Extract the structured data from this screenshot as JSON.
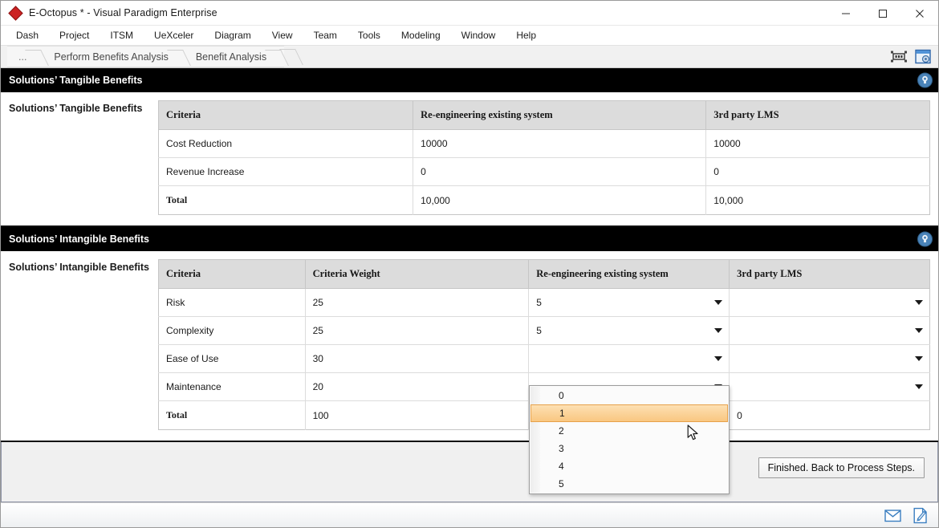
{
  "window": {
    "title": "E-Octopus * - Visual Paradigm Enterprise",
    "logo_icon": "vp-diamond-logo-icon",
    "minimize_label": "—",
    "maximize_label": "☐",
    "close_label": "✕"
  },
  "menubar": {
    "items": [
      {
        "label": "Dash"
      },
      {
        "label": "Project"
      },
      {
        "label": "ITSM"
      },
      {
        "label": "UeXceler"
      },
      {
        "label": "Diagram"
      },
      {
        "label": "View"
      },
      {
        "label": "Team"
      },
      {
        "label": "Tools"
      },
      {
        "label": "Modeling"
      },
      {
        "label": "Window"
      },
      {
        "label": "Help"
      }
    ]
  },
  "breadcrumb": {
    "items": [
      {
        "label": "..."
      },
      {
        "label": "Perform Benefits Analysis"
      },
      {
        "label": "Benefit Analysis"
      }
    ],
    "tools": [
      {
        "icon": "fit-diagram-icon"
      },
      {
        "icon": "open-spec-window-icon"
      }
    ]
  },
  "sections": [
    {
      "bar_title": "Solutions’ Tangible Benefits",
      "badge_icon": "info-bulb-badge-icon",
      "left_label": "Solutions’ Tangible Benefits",
      "table": {
        "columns": [
          "Criteria",
          "Re-engineering existing system",
          "3rd party LMS"
        ],
        "rows": [
          {
            "cells": [
              "Cost Reduction",
              "10000",
              "10000"
            ],
            "total": false
          },
          {
            "cells": [
              "Revenue Increase",
              "0",
              "0"
            ],
            "total": false
          },
          {
            "cells": [
              "Total",
              "10,000",
              "10,000"
            ],
            "total": true
          }
        ]
      }
    },
    {
      "bar_title": "Solutions’ Intangible Benefits",
      "badge_icon": "info-bulb-badge-icon",
      "left_label": "Solutions’ Intangible Benefits",
      "table": {
        "columns": [
          "Criteria",
          "Criteria Weight",
          "Re-engineering existing system",
          "3rd party LMS"
        ],
        "rows": [
          {
            "cells": [
              "Risk",
              "25",
              "5",
              ""
            ],
            "total": false,
            "select_cols": [
              2,
              3
            ]
          },
          {
            "cells": [
              "Complexity",
              "25",
              "5",
              ""
            ],
            "total": false,
            "select_cols": [
              2,
              3
            ]
          },
          {
            "cells": [
              "Ease of Use",
              "30",
              "",
              ""
            ],
            "total": false,
            "select_cols": [
              2,
              3
            ]
          },
          {
            "cells": [
              "Maintenance",
              "20",
              "",
              ""
            ],
            "total": false,
            "select_cols": [
              2,
              3
            ]
          },
          {
            "cells": [
              "Total",
              "100",
              "",
              "0"
            ],
            "total": true,
            "select_cols": []
          }
        ]
      }
    }
  ],
  "dropdown": {
    "open": true,
    "options": [
      "0",
      "1",
      "2",
      "3",
      "4",
      "5"
    ],
    "selected_index": 1,
    "highlight_color": "#f9c781",
    "highlight_border": "#e6a14a"
  },
  "footer": {
    "finish_button_label": "Finished. Back to Process Steps."
  },
  "statusbar": {
    "icons": [
      {
        "name": "mail-icon"
      },
      {
        "name": "edit-document-icon"
      }
    ]
  }
}
